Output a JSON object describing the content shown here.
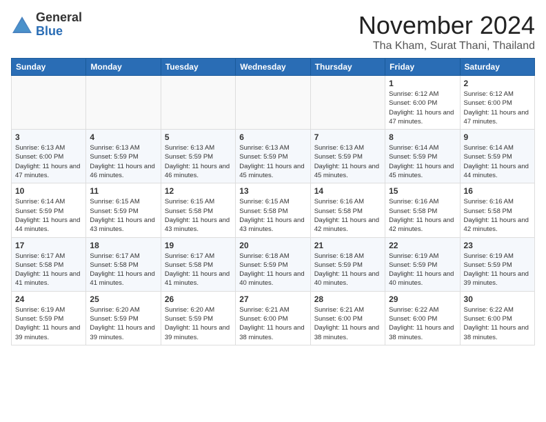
{
  "logo": {
    "general": "General",
    "blue": "Blue"
  },
  "header": {
    "month": "November 2024",
    "location": "Tha Kham, Surat Thani, Thailand"
  },
  "weekdays": [
    "Sunday",
    "Monday",
    "Tuesday",
    "Wednesday",
    "Thursday",
    "Friday",
    "Saturday"
  ],
  "weeks": [
    [
      {
        "day": "",
        "info": ""
      },
      {
        "day": "",
        "info": ""
      },
      {
        "day": "",
        "info": ""
      },
      {
        "day": "",
        "info": ""
      },
      {
        "day": "",
        "info": ""
      },
      {
        "day": "1",
        "info": "Sunrise: 6:12 AM\nSunset: 6:00 PM\nDaylight: 11 hours and 47 minutes."
      },
      {
        "day": "2",
        "info": "Sunrise: 6:12 AM\nSunset: 6:00 PM\nDaylight: 11 hours and 47 minutes."
      }
    ],
    [
      {
        "day": "3",
        "info": "Sunrise: 6:13 AM\nSunset: 6:00 PM\nDaylight: 11 hours and 47 minutes."
      },
      {
        "day": "4",
        "info": "Sunrise: 6:13 AM\nSunset: 5:59 PM\nDaylight: 11 hours and 46 minutes."
      },
      {
        "day": "5",
        "info": "Sunrise: 6:13 AM\nSunset: 5:59 PM\nDaylight: 11 hours and 46 minutes."
      },
      {
        "day": "6",
        "info": "Sunrise: 6:13 AM\nSunset: 5:59 PM\nDaylight: 11 hours and 45 minutes."
      },
      {
        "day": "7",
        "info": "Sunrise: 6:13 AM\nSunset: 5:59 PM\nDaylight: 11 hours and 45 minutes."
      },
      {
        "day": "8",
        "info": "Sunrise: 6:14 AM\nSunset: 5:59 PM\nDaylight: 11 hours and 45 minutes."
      },
      {
        "day": "9",
        "info": "Sunrise: 6:14 AM\nSunset: 5:59 PM\nDaylight: 11 hours and 44 minutes."
      }
    ],
    [
      {
        "day": "10",
        "info": "Sunrise: 6:14 AM\nSunset: 5:59 PM\nDaylight: 11 hours and 44 minutes."
      },
      {
        "day": "11",
        "info": "Sunrise: 6:15 AM\nSunset: 5:59 PM\nDaylight: 11 hours and 43 minutes."
      },
      {
        "day": "12",
        "info": "Sunrise: 6:15 AM\nSunset: 5:58 PM\nDaylight: 11 hours and 43 minutes."
      },
      {
        "day": "13",
        "info": "Sunrise: 6:15 AM\nSunset: 5:58 PM\nDaylight: 11 hours and 43 minutes."
      },
      {
        "day": "14",
        "info": "Sunrise: 6:16 AM\nSunset: 5:58 PM\nDaylight: 11 hours and 42 minutes."
      },
      {
        "day": "15",
        "info": "Sunrise: 6:16 AM\nSunset: 5:58 PM\nDaylight: 11 hours and 42 minutes."
      },
      {
        "day": "16",
        "info": "Sunrise: 6:16 AM\nSunset: 5:58 PM\nDaylight: 11 hours and 42 minutes."
      }
    ],
    [
      {
        "day": "17",
        "info": "Sunrise: 6:17 AM\nSunset: 5:58 PM\nDaylight: 11 hours and 41 minutes."
      },
      {
        "day": "18",
        "info": "Sunrise: 6:17 AM\nSunset: 5:58 PM\nDaylight: 11 hours and 41 minutes."
      },
      {
        "day": "19",
        "info": "Sunrise: 6:17 AM\nSunset: 5:58 PM\nDaylight: 11 hours and 41 minutes."
      },
      {
        "day": "20",
        "info": "Sunrise: 6:18 AM\nSunset: 5:59 PM\nDaylight: 11 hours and 40 minutes."
      },
      {
        "day": "21",
        "info": "Sunrise: 6:18 AM\nSunset: 5:59 PM\nDaylight: 11 hours and 40 minutes."
      },
      {
        "day": "22",
        "info": "Sunrise: 6:19 AM\nSunset: 5:59 PM\nDaylight: 11 hours and 40 minutes."
      },
      {
        "day": "23",
        "info": "Sunrise: 6:19 AM\nSunset: 5:59 PM\nDaylight: 11 hours and 39 minutes."
      }
    ],
    [
      {
        "day": "24",
        "info": "Sunrise: 6:19 AM\nSunset: 5:59 PM\nDaylight: 11 hours and 39 minutes."
      },
      {
        "day": "25",
        "info": "Sunrise: 6:20 AM\nSunset: 5:59 PM\nDaylight: 11 hours and 39 minutes."
      },
      {
        "day": "26",
        "info": "Sunrise: 6:20 AM\nSunset: 5:59 PM\nDaylight: 11 hours and 39 minutes."
      },
      {
        "day": "27",
        "info": "Sunrise: 6:21 AM\nSunset: 6:00 PM\nDaylight: 11 hours and 38 minutes."
      },
      {
        "day": "28",
        "info": "Sunrise: 6:21 AM\nSunset: 6:00 PM\nDaylight: 11 hours and 38 minutes."
      },
      {
        "day": "29",
        "info": "Sunrise: 6:22 AM\nSunset: 6:00 PM\nDaylight: 11 hours and 38 minutes."
      },
      {
        "day": "30",
        "info": "Sunrise: 6:22 AM\nSunset: 6:00 PM\nDaylight: 11 hours and 38 minutes."
      }
    ]
  ]
}
